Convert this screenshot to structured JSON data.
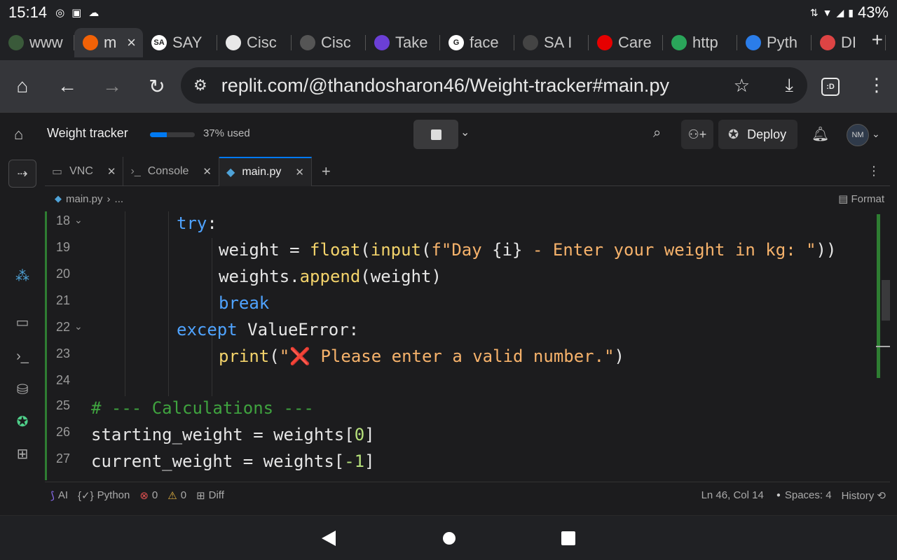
{
  "status": {
    "time": "15:14",
    "battery": "43%"
  },
  "browser_tabs": [
    {
      "label": "www",
      "fav_color": "#3a5a3a",
      "fav_text": ""
    },
    {
      "label": "m",
      "fav_color": "#f26207",
      "fav_text": "",
      "active": true
    },
    {
      "label": "SAY",
      "fav_color": "#ffffff",
      "fav_text": "SA"
    },
    {
      "label": "Cisc",
      "fav_color": "#e8e8e8",
      "fav_text": ""
    },
    {
      "label": "Cisc",
      "fav_color": "#555555",
      "fav_text": ""
    },
    {
      "label": "Take",
      "fav_color": "#6b3fd6",
      "fav_text": ""
    },
    {
      "label": "face",
      "fav_color": "#ffffff",
      "fav_text": "G"
    },
    {
      "label": "SA I",
      "fav_color": "#444444",
      "fav_text": ""
    },
    {
      "label": "Care",
      "fav_color": "#e60000",
      "fav_text": ""
    },
    {
      "label": "http",
      "fav_color": "#2aa55a",
      "fav_text": ""
    },
    {
      "label": "Pyth",
      "fav_color": "#2b7de9",
      "fav_text": ""
    },
    {
      "label": "DI",
      "fav_color": "#d44",
      "fav_text": ""
    }
  ],
  "address": {
    "url": "replit.com/@thandosharon46/Weight-tracker#main.py",
    "tab_count": ":D"
  },
  "replit_header": {
    "project_title": "Weight tracker",
    "usage_text": "37% used",
    "usage_fraction": 0.37,
    "deploy_label": "Deploy",
    "avatar_initials": "NM"
  },
  "editor_tabs": [
    {
      "label": "VNC",
      "icon": "monitor-icon"
    },
    {
      "label": "Console",
      "icon": "terminal-icon"
    },
    {
      "label": "main.py",
      "icon": "python-icon",
      "active": true
    }
  ],
  "breadcrumb": {
    "file": "main.py",
    "rest": "...",
    "format_label": "Format"
  },
  "code_lines": [
    {
      "n": "18",
      "fold": true,
      "indent": 2,
      "html": "<span class='kw'>try</span>:"
    },
    {
      "n": "19",
      "fold": false,
      "indent": 3,
      "html": "weight = <span class='fn'>float</span>(<span class='fn'>input</span>(<span class='str'>f\"Day </span>{i}<span class='str'> - Enter your weight in kg: \"</span>))"
    },
    {
      "n": "20",
      "fold": false,
      "indent": 3,
      "html": "weights.<span class='fn'>append</span>(weight)"
    },
    {
      "n": "21",
      "fold": false,
      "indent": 3,
      "html": "<span class='kw'>break</span>"
    },
    {
      "n": "22",
      "fold": true,
      "indent": 2,
      "html": "<span class='kw'>except</span> ValueError:"
    },
    {
      "n": "23",
      "fold": false,
      "indent": 3,
      "html": "<span class='fn'>print</span>(<span class='str'>\"❌ Please enter a valid number.\"</span>)"
    },
    {
      "n": "24",
      "fold": false,
      "indent": 0,
      "html": ""
    },
    {
      "n": "25",
      "fold": false,
      "indent": 0,
      "html": "<span class='cmt'># --- Calculations ---</span>"
    },
    {
      "n": "26",
      "fold": false,
      "indent": 0,
      "html": "starting_weight = weights[<span class='num'>0</span>]"
    },
    {
      "n": "27",
      "fold": false,
      "indent": 0,
      "html": "current_weight = weights[<span class='num'>-1</span>]"
    }
  ],
  "footer": {
    "ai": "AI",
    "lang": "Python",
    "errors": "0",
    "warnings": "0",
    "diff": "Diff",
    "position": "Ln 46, Col 14",
    "spaces": "Spaces: 4",
    "history": "History"
  }
}
